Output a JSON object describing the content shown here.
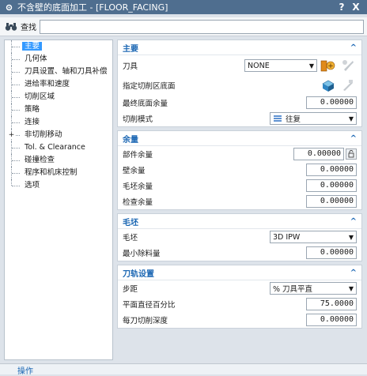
{
  "window": {
    "title": "不含壁的底面加工 - [FLOOR_FACING]",
    "help_label": "?",
    "close_label": "X"
  },
  "search": {
    "label": "查找",
    "value": "",
    "placeholder": ""
  },
  "tree": {
    "items": [
      {
        "label": "主要",
        "selected": true
      },
      {
        "label": "几何体"
      },
      {
        "label": "刀具设置、轴和刀具补偿"
      },
      {
        "label": "进给率和速度"
      },
      {
        "label": "切削区域"
      },
      {
        "label": "策略"
      },
      {
        "label": "连接"
      },
      {
        "label": "非切削移动",
        "expander": "+"
      },
      {
        "label": "Tol. & Clearance"
      },
      {
        "label": "碰撞检查"
      },
      {
        "label": "程序和机床控制"
      },
      {
        "label": "选项"
      }
    ]
  },
  "groups": {
    "main": {
      "title": "主要",
      "collapse": "^",
      "tool_label": "刀具",
      "tool_value": "NONE",
      "cut_area_label": "指定切削区底面",
      "final_floor_label": "最终底面余量",
      "final_floor_value": "0.00000",
      "cut_mode_label": "切削模式",
      "cut_mode_value": "往复"
    },
    "stock": {
      "title": "余量",
      "collapse": "^",
      "part_stock_label": "部件余量",
      "part_stock_value": "0.00000",
      "wall_stock_label": "壁余量",
      "wall_stock_value": "0.00000",
      "blank_stock_label": "毛坯余量",
      "blank_stock_value": "0.00000",
      "check_stock_label": "检查余量",
      "check_stock_value": "0.00000"
    },
    "blank": {
      "title": "毛坯",
      "collapse": "^",
      "blank_label": "毛坯",
      "blank_value": "3D IPW",
      "min_remove_label": "最小除料量",
      "min_remove_value": "0.00000"
    },
    "path": {
      "title": "刀轨设置",
      "collapse": "^",
      "stepover_label": "步距",
      "stepover_value": "% 刀具平直",
      "percent_label": "平面直径百分比",
      "percent_value": "75.0000",
      "depth_label": "每刀切削深度",
      "depth_value": "0.00000"
    }
  },
  "footer": {
    "label": "操作"
  },
  "icons": {
    "title": "settings-icon",
    "search": "binoculars-icon",
    "new_tool": "new-tool-icon",
    "edit_tool": "edit-tool-icon",
    "select_face": "select-face-icon",
    "display_face": "display-face-icon",
    "lock": "lock-icon",
    "zigzag": "zigzag-pattern-icon"
  },
  "colors": {
    "titlebar": "#4f6e8f",
    "group_header": "#1a66b3",
    "selection": "#3399ff",
    "background": "#dde3ea"
  }
}
